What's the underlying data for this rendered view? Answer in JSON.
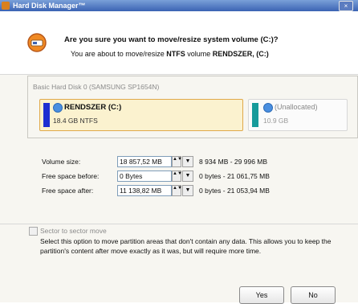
{
  "window": {
    "title": "Hard Disk Manager™",
    "close_label": "×"
  },
  "header": {
    "question": "Are you sure you want to move/resize system volume (C:)?",
    "sub_prefix": "You are about to move/resize ",
    "sub_fs": "NTFS",
    "sub_middle": " volume ",
    "sub_volume": "RENDSZER, (C:)"
  },
  "disk": {
    "title": "Basic Hard Disk 0 (SAMSUNG SP1654N)",
    "partitions": [
      {
        "name": "RENDSZER (C:)",
        "size": "18.4 GB NTFS",
        "color": "#1d2fd1"
      },
      {
        "name": "(Unallocated)",
        "size": "10.9 GB",
        "color": "#169b9b"
      }
    ]
  },
  "fields": {
    "volume_size": {
      "label": "Volume size:",
      "value": "18 857,52 MB",
      "range": "8 934 MB - 29 996 MB"
    },
    "free_before": {
      "label": "Free space before:",
      "value": "0 Bytes",
      "range": "0 bytes - 21 061,75 MB"
    },
    "free_after": {
      "label": "Free space after:",
      "value": "11 138,82 MB",
      "range": "0 bytes - 21 053,94 MB"
    }
  },
  "option": {
    "checkbox_label": "Sector to sector move",
    "description": "Select this option to move partition areas that don't contain any data. This allows you to keep the partition's content after move exactly as it was, but will require more time."
  },
  "buttons": {
    "yes": "Yes",
    "no": "No"
  },
  "icons": {
    "spin": "▲▼",
    "dropdown": "▼"
  }
}
